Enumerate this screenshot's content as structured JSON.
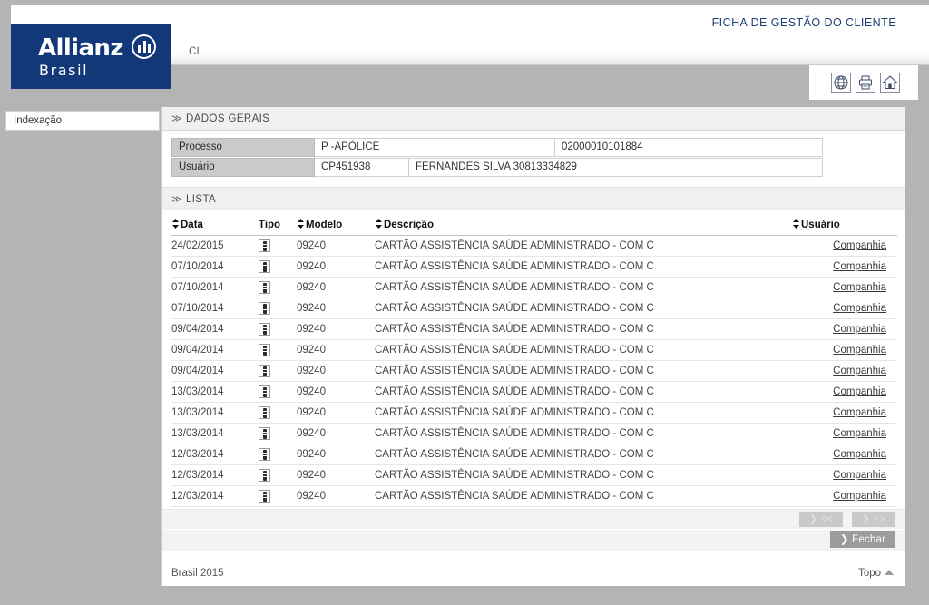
{
  "header": {
    "app_title": "FICHA DE GESTÃO DO CLIENTE",
    "tab_label": "CL",
    "logo_word": "Allianz",
    "logo_sub": "Brasil",
    "brand_color": "#13387a",
    "toolbar_icons": [
      {
        "name": "globe-icon",
        "label": "Idioma"
      },
      {
        "name": "printer-icon",
        "label": "Imprimir"
      },
      {
        "name": "home-icon",
        "label": "Início"
      }
    ]
  },
  "sidebar": {
    "items": [
      {
        "label": "Indexação"
      }
    ]
  },
  "sections": {
    "dados_gerais": {
      "title": "DADOS GERAIS",
      "collapse_glyph": "≫",
      "fields": [
        {
          "label": "Processo",
          "value_a": "P -APÓLICE",
          "value_b": "02000010101884"
        },
        {
          "label": "Usuário",
          "value_a": "CP451938",
          "value_b": "FERNANDES SILVA 30813334829"
        }
      ]
    },
    "lista": {
      "title": "LISTA",
      "collapse_glyph": "≫",
      "columns": [
        {
          "key": "data",
          "label": "Data",
          "sortable": true
        },
        {
          "key": "tipo",
          "label": "Tipo",
          "sortable": false
        },
        {
          "key": "modelo",
          "label": "Modelo",
          "sortable": true
        },
        {
          "key": "descricao",
          "label": "Descrição",
          "sortable": true
        },
        {
          "key": "usuario",
          "label": "Usuário",
          "sortable": true
        }
      ],
      "rows": [
        {
          "data": "24/02/2015",
          "tipo": "document-icon",
          "modelo": "09240",
          "descricao": "CARTÃO ASSISTÊNCIA SAÚDE ADMINISTRADO - COM C",
          "usuario": "Companhia"
        },
        {
          "data": "07/10/2014",
          "tipo": "document-icon",
          "modelo": "09240",
          "descricao": "CARTÃO ASSISTÊNCIA SAÚDE ADMINISTRADO - COM C",
          "usuario": "Companhia"
        },
        {
          "data": "07/10/2014",
          "tipo": "document-icon",
          "modelo": "09240",
          "descricao": "CARTÃO ASSISTÊNCIA SAÚDE ADMINISTRADO - COM C",
          "usuario": "Companhia"
        },
        {
          "data": "07/10/2014",
          "tipo": "document-icon",
          "modelo": "09240",
          "descricao": "CARTÃO ASSISTÊNCIA SAÚDE ADMINISTRADO - COM C",
          "usuario": "Companhia"
        },
        {
          "data": "09/04/2014",
          "tipo": "document-icon",
          "modelo": "09240",
          "descricao": "CARTÃO ASSISTÊNCIA SAÚDE ADMINISTRADO - COM C",
          "usuario": "Companhia"
        },
        {
          "data": "09/04/2014",
          "tipo": "document-icon",
          "modelo": "09240",
          "descricao": "CARTÃO ASSISTÊNCIA SAÚDE ADMINISTRADO - COM C",
          "usuario": "Companhia"
        },
        {
          "data": "09/04/2014",
          "tipo": "document-icon",
          "modelo": "09240",
          "descricao": "CARTÃO ASSISTÊNCIA SAÚDE ADMINISTRADO - COM C",
          "usuario": "Companhia"
        },
        {
          "data": "13/03/2014",
          "tipo": "document-icon",
          "modelo": "09240",
          "descricao": "CARTÃO ASSISTÊNCIA SAÚDE ADMINISTRADO - COM C",
          "usuario": "Companhia"
        },
        {
          "data": "13/03/2014",
          "tipo": "document-icon",
          "modelo": "09240",
          "descricao": "CARTÃO ASSISTÊNCIA SAÚDE ADMINISTRADO - COM C",
          "usuario": "Companhia"
        },
        {
          "data": "13/03/2014",
          "tipo": "document-icon",
          "modelo": "09240",
          "descricao": "CARTÃO ASSISTÊNCIA SAÚDE ADMINISTRADO - COM C",
          "usuario": "Companhia"
        },
        {
          "data": "12/03/2014",
          "tipo": "document-icon",
          "modelo": "09240",
          "descricao": "CARTÃO ASSISTÊNCIA SAÚDE ADMINISTRADO - COM C",
          "usuario": "Companhia"
        },
        {
          "data": "12/03/2014",
          "tipo": "document-icon",
          "modelo": "09240",
          "descricao": "CARTÃO ASSISTÊNCIA SAÚDE ADMINISTRADO - COM C",
          "usuario": "Companhia"
        },
        {
          "data": "12/03/2014",
          "tipo": "document-icon",
          "modelo": "09240",
          "descricao": "CARTÃO ASSISTÊNCIA SAÚDE ADMINISTRADO - COM C",
          "usuario": "Companhia"
        }
      ]
    }
  },
  "pager": {
    "prev_label": "❯ <<",
    "next_label": "❯ >>",
    "prev_enabled": false,
    "next_enabled": false
  },
  "actions": {
    "close_label": "❯ Fechar"
  },
  "footer": {
    "left_text": "Brasil 2015",
    "top_link": "Topo"
  }
}
